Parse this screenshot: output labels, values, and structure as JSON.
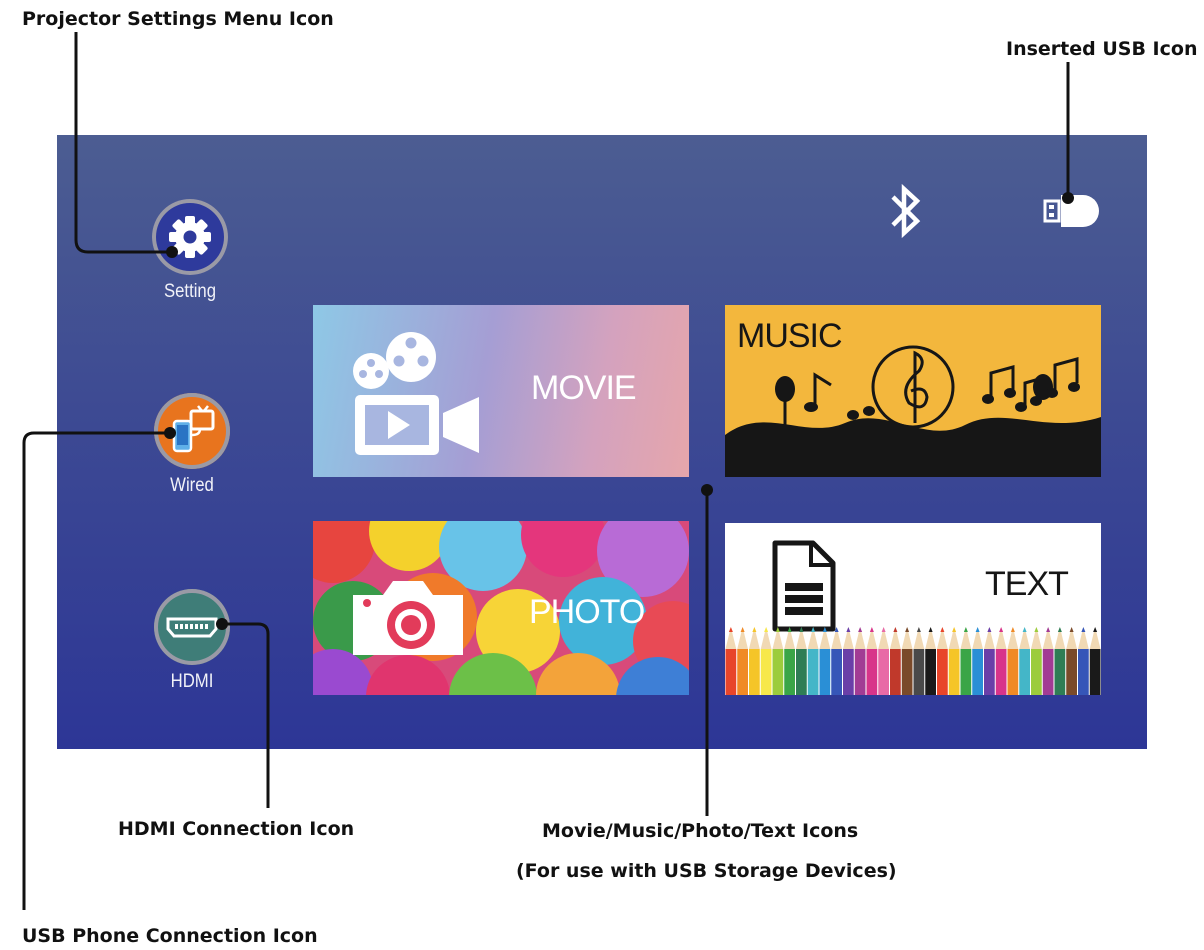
{
  "callouts": {
    "settings": "Projector Settings Menu Icon",
    "usb_inserted": "Inserted USB Icon",
    "hdmi": "HDMI Connection Icon",
    "media_line1": "Movie/Music/Photo/Text Icons",
    "media_line2": "(For use with USB Storage Devices)",
    "phone": "USB Phone Connection Icon"
  },
  "sidebar": {
    "setting_label": "Setting",
    "wired_label": "Wired",
    "hdmi_label": "HDMI"
  },
  "status_icons": [
    "bluetooth-icon",
    "usb-drive-icon"
  ],
  "tiles": {
    "movie": "MOVIE",
    "music": "MUSIC",
    "photo": "PHOTO",
    "text": "TEXT"
  },
  "colors": {
    "setting_button": "#2e3a9c",
    "wired_button": "#e8741e",
    "hdmi_button": "#3f7d78",
    "music_tile": "#f3b73d"
  }
}
